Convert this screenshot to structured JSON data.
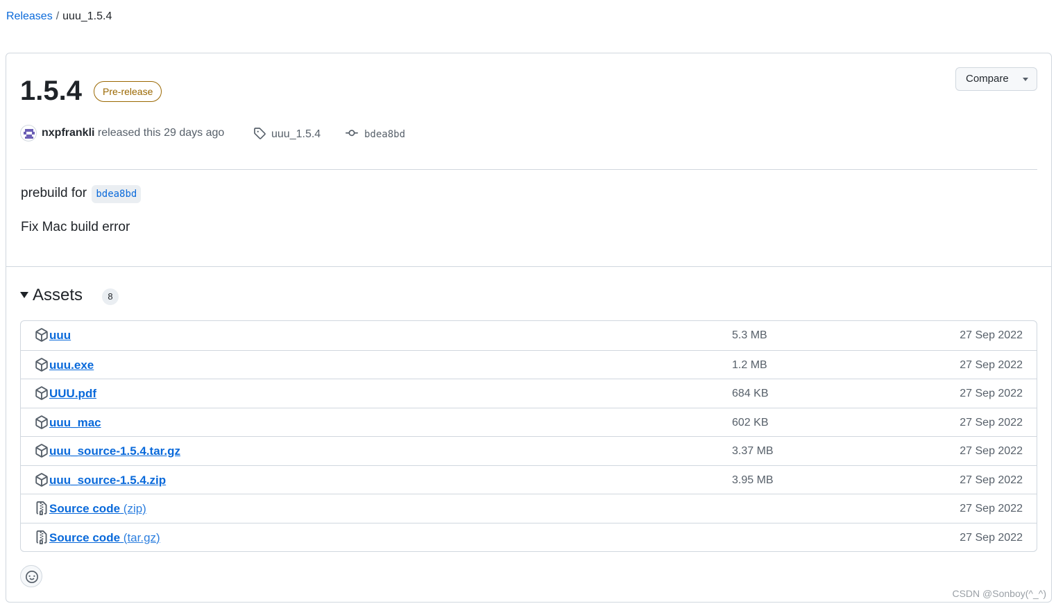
{
  "breadcrumb": {
    "parent": "Releases",
    "separator": "/",
    "current": "uuu_1.5.4"
  },
  "release": {
    "title": "1.5.4",
    "badge": "Pre-release",
    "compare_label": "Compare",
    "author": "nxpfrankli",
    "released_text": "released this 29 days ago",
    "tag": "uuu_1.5.4",
    "commit": "bdea8bd",
    "body": {
      "prebuild_text": "prebuild for",
      "prebuild_commit": "bdea8bd",
      "note": "Fix Mac build error"
    }
  },
  "assets": {
    "heading": "Assets",
    "count": "8",
    "items": [
      {
        "name": "uuu",
        "ext": "",
        "size": "5.3 MB",
        "date": "27 Sep 2022",
        "icon": "package-icon"
      },
      {
        "name": "uuu.exe",
        "ext": "",
        "size": "1.2 MB",
        "date": "27 Sep 2022",
        "icon": "package-icon"
      },
      {
        "name": "UUU.pdf",
        "ext": "",
        "size": "684 KB",
        "date": "27 Sep 2022",
        "icon": "package-icon"
      },
      {
        "name": "uuu_mac",
        "ext": "",
        "size": "602 KB",
        "date": "27 Sep 2022",
        "icon": "package-icon"
      },
      {
        "name": "uuu_source-1.5.4.tar.gz",
        "ext": "",
        "size": "3.37 MB",
        "date": "27 Sep 2022",
        "icon": "package-icon"
      },
      {
        "name": "uuu_source-1.5.4.zip",
        "ext": "",
        "size": "3.95 MB",
        "date": "27 Sep 2022",
        "icon": "package-icon"
      },
      {
        "name": "Source code",
        "ext": "(zip)",
        "size": "",
        "date": "27 Sep 2022",
        "icon": "file-zip-icon"
      },
      {
        "name": "Source code",
        "ext": "(tar.gz)",
        "size": "",
        "date": "27 Sep 2022",
        "icon": "file-zip-icon"
      }
    ]
  },
  "watermark": "CSDN @Sonboy(^_^)",
  "colors": {
    "link": "#0969da",
    "prerelease": "#9a6700",
    "border": "#d0d7de",
    "muted": "#57606a"
  }
}
